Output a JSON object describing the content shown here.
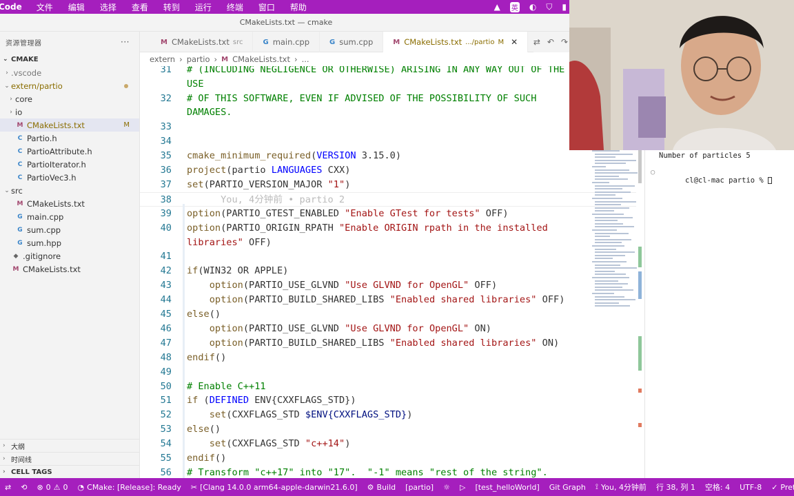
{
  "menubar": {
    "app_name": "Code",
    "items": [
      "文件",
      "编辑",
      "选择",
      "查看",
      "转到",
      "运行",
      "终端",
      "窗口",
      "帮助"
    ],
    "tray_ime": "英"
  },
  "window_title": "CMakeLists.txt — cmake",
  "sidebar": {
    "header": "资源管理器",
    "more": "···",
    "root": "CMAKE",
    "tree": [
      {
        "label": ".vscode",
        "indent": 1,
        "kind": "folder",
        "chev": "›",
        "muted": true
      },
      {
        "label": "extern/partio",
        "indent": 1,
        "kind": "folder",
        "chev": "⌄",
        "dot": true,
        "accent": true
      },
      {
        "label": "core",
        "indent": 2,
        "kind": "folder",
        "chev": "›"
      },
      {
        "label": "io",
        "indent": 2,
        "kind": "folder",
        "chev": "›"
      },
      {
        "label": "CMakeLists.txt",
        "indent": 2,
        "kind": "M",
        "badge": "M",
        "selected": true,
        "accent": true
      },
      {
        "label": "Partio.h",
        "indent": 2,
        "kind": "C"
      },
      {
        "label": "PartioAttribute.h",
        "indent": 2,
        "kind": "C"
      },
      {
        "label": "PartioIterator.h",
        "indent": 2,
        "kind": "C"
      },
      {
        "label": "PartioVec3.h",
        "indent": 2,
        "kind": "C"
      },
      {
        "label": "src",
        "indent": 1,
        "kind": "folder",
        "chev": "⌄"
      },
      {
        "label": "CMakeLists.txt",
        "indent": 2,
        "kind": "M"
      },
      {
        "label": "main.cpp",
        "indent": 2,
        "kind": "G"
      },
      {
        "label": "sum.cpp",
        "indent": 2,
        "kind": "G"
      },
      {
        "label": "sum.hpp",
        "indent": 2,
        "kind": "G"
      },
      {
        "label": ".gitignore",
        "indent": 1,
        "kind": "git"
      },
      {
        "label": "CMakeLists.txt",
        "indent": 1,
        "kind": "M"
      }
    ],
    "panels": [
      "大纲",
      "时间线",
      "CELL TAGS"
    ]
  },
  "tabs": [
    {
      "icon": "M",
      "label": "CMakeLists.txt",
      "sub": "src",
      "active": false
    },
    {
      "icon": "G",
      "label": "main.cpp",
      "sub": "",
      "active": false
    },
    {
      "icon": "G",
      "label": "sum.cpp",
      "sub": "",
      "active": false
    },
    {
      "icon": "M",
      "label": "CMakeLists.txt",
      "sub": ".../partio",
      "badge": "M",
      "active": true
    }
  ],
  "breadcrumb": [
    "extern",
    "partio",
    "CMakeLists.txt",
    "..."
  ],
  "editor": {
    "lines": [
      {
        "n": "31",
        "tokens": [
          [
            "cm",
            "# (INCLUDING NEGLIGENCE OR OTHERWISE) ARISING IN ANY WAY OUT OF THE"
          ]
        ],
        "wrap": [
          [
            "cm",
            "USE"
          ]
        ],
        "partial": true
      },
      {
        "n": "32",
        "tokens": [
          [
            "cm",
            "# OF THIS SOFTWARE, EVEN IF ADVISED OF THE POSSIBILITY OF SUCH"
          ]
        ],
        "wrap": [
          [
            "cm",
            "DAMAGES."
          ]
        ]
      },
      {
        "n": "33",
        "tokens": []
      },
      {
        "n": "34",
        "tokens": []
      },
      {
        "n": "35",
        "tokens": [
          [
            "fn",
            "cmake_minimum_required"
          ],
          [
            "",
            "("
          ],
          [
            "kw",
            "VERSION"
          ],
          [
            "",
            " 3.15.0)"
          ]
        ]
      },
      {
        "n": "36",
        "tokens": [
          [
            "fn",
            "project"
          ],
          [
            "",
            "(partio "
          ],
          [
            "kw",
            "LANGUAGES"
          ],
          [
            "",
            " CXX)"
          ]
        ]
      },
      {
        "n": "37",
        "tokens": [
          [
            "fn",
            "set"
          ],
          [
            "",
            "(PARTIO_VERSION_MAJOR "
          ],
          [
            "st",
            "\"1\""
          ],
          [
            "",
            ")"
          ]
        ]
      },
      {
        "n": "38",
        "tokens": [
          [
            "ghost",
            "      You, 4分钟前 • partio 2"
          ]
        ],
        "current": true
      },
      {
        "n": "39",
        "tokens": [
          [
            "fn",
            "option"
          ],
          [
            "",
            "(PARTIO_GTEST_ENABLED "
          ],
          [
            "st",
            "\"Enable GTest for tests\""
          ],
          [
            "",
            " OFF)"
          ]
        ]
      },
      {
        "n": "40",
        "tokens": [
          [
            "fn",
            "option"
          ],
          [
            "",
            "(PARTIO_ORIGIN_RPATH "
          ],
          [
            "st",
            "\"Enable ORIGIN rpath in the installed"
          ]
        ],
        "wrap": [
          [
            "st",
            "libraries\""
          ],
          [
            "",
            " OFF)"
          ]
        ]
      },
      {
        "n": "41",
        "tokens": []
      },
      {
        "n": "42",
        "tokens": [
          [
            "fn",
            "if"
          ],
          [
            "",
            "(WIN32 OR APPLE)"
          ]
        ]
      },
      {
        "n": "43",
        "tokens": [
          [
            "",
            "    "
          ],
          [
            "fn",
            "option"
          ],
          [
            "",
            "(PARTIO_USE_GLVND "
          ],
          [
            "st",
            "\"Use GLVND for OpenGL\""
          ],
          [
            "",
            " OFF)"
          ]
        ]
      },
      {
        "n": "44",
        "tokens": [
          [
            "",
            "    "
          ],
          [
            "fn",
            "option"
          ],
          [
            "",
            "(PARTIO_BUILD_SHARED_LIBS "
          ],
          [
            "st",
            "\"Enabled shared libraries\""
          ],
          [
            "",
            " OFF)"
          ]
        ]
      },
      {
        "n": "45",
        "tokens": [
          [
            "fn",
            "else"
          ],
          [
            "",
            "()"
          ]
        ]
      },
      {
        "n": "46",
        "tokens": [
          [
            "",
            "    "
          ],
          [
            "fn",
            "option"
          ],
          [
            "",
            "(PARTIO_USE_GLVND "
          ],
          [
            "st",
            "\"Use GLVND for OpenGL\""
          ],
          [
            "",
            " ON)"
          ]
        ]
      },
      {
        "n": "47",
        "tokens": [
          [
            "",
            "    "
          ],
          [
            "fn",
            "option"
          ],
          [
            "",
            "(PARTIO_BUILD_SHARED_LIBS "
          ],
          [
            "st",
            "\"Enabled shared libraries\""
          ],
          [
            "",
            " ON)"
          ]
        ]
      },
      {
        "n": "48",
        "tokens": [
          [
            "fn",
            "endif"
          ],
          [
            "",
            "()"
          ]
        ]
      },
      {
        "n": "49",
        "tokens": []
      },
      {
        "n": "50",
        "tokens": [
          [
            "cm",
            "# Enable C++11"
          ]
        ]
      },
      {
        "n": "51",
        "tokens": [
          [
            "fn",
            "if"
          ],
          [
            "",
            " ("
          ],
          [
            "kw",
            "DEFINED"
          ],
          [
            "",
            " ENV{CXXFLAGS_STD})"
          ]
        ]
      },
      {
        "n": "52",
        "tokens": [
          [
            "",
            "    "
          ],
          [
            "fn",
            "set"
          ],
          [
            "",
            "(CXXFLAGS_STD "
          ],
          [
            "vr",
            "$ENV{CXXFLAGS_STD}"
          ],
          [
            "",
            ")"
          ]
        ]
      },
      {
        "n": "53",
        "tokens": [
          [
            "fn",
            "else"
          ],
          [
            "",
            "()"
          ]
        ]
      },
      {
        "n": "54",
        "tokens": [
          [
            "",
            "    "
          ],
          [
            "fn",
            "set"
          ],
          [
            "",
            "(CXXFLAGS_STD "
          ],
          [
            "st",
            "\"c++14\""
          ],
          [
            "",
            ")"
          ]
        ]
      },
      {
        "n": "55",
        "tokens": [
          [
            "fn",
            "endif"
          ],
          [
            "",
            "()"
          ]
        ]
      },
      {
        "n": "56",
        "tokens": [
          [
            "cm",
            "# Transform \"c++17\" into \"17\".  \"-1\" means \"rest of the string\"."
          ]
        ]
      },
      {
        "n": "57",
        "tokens": [
          [
            "fn",
            "if"
          ],
          [
            "",
            " (NOT DEFINED VFX_PLATFORM)"
          ]
        ],
        "partial": true
      }
    ]
  },
  "terminal": {
    "lines": [
      "Number of particles 5",
      "cl@cl-mac partio % "
    ]
  },
  "statusbar": {
    "remote": "⇄",
    "errors": "0",
    "warnings": "0",
    "cmake_status": "CMake: [Release]: Ready",
    "kit": "[Clang 14.0.0 arm64-apple-darwin21.6.0]",
    "build": "Build",
    "target": "[partio]",
    "launch_target": "[test_helloWorld]",
    "git_graph": "Git Graph",
    "blame": "You, 4分钟前",
    "position": "行 38, 列 1",
    "spaces": "空格: 4",
    "encoding": "UTF-8",
    "prettier": "Prettier"
  },
  "colors": {
    "statusbar": "#a51fbd",
    "comment": "#008000",
    "keyword": "#0000ff",
    "function": "#795e26",
    "string": "#a31515"
  }
}
